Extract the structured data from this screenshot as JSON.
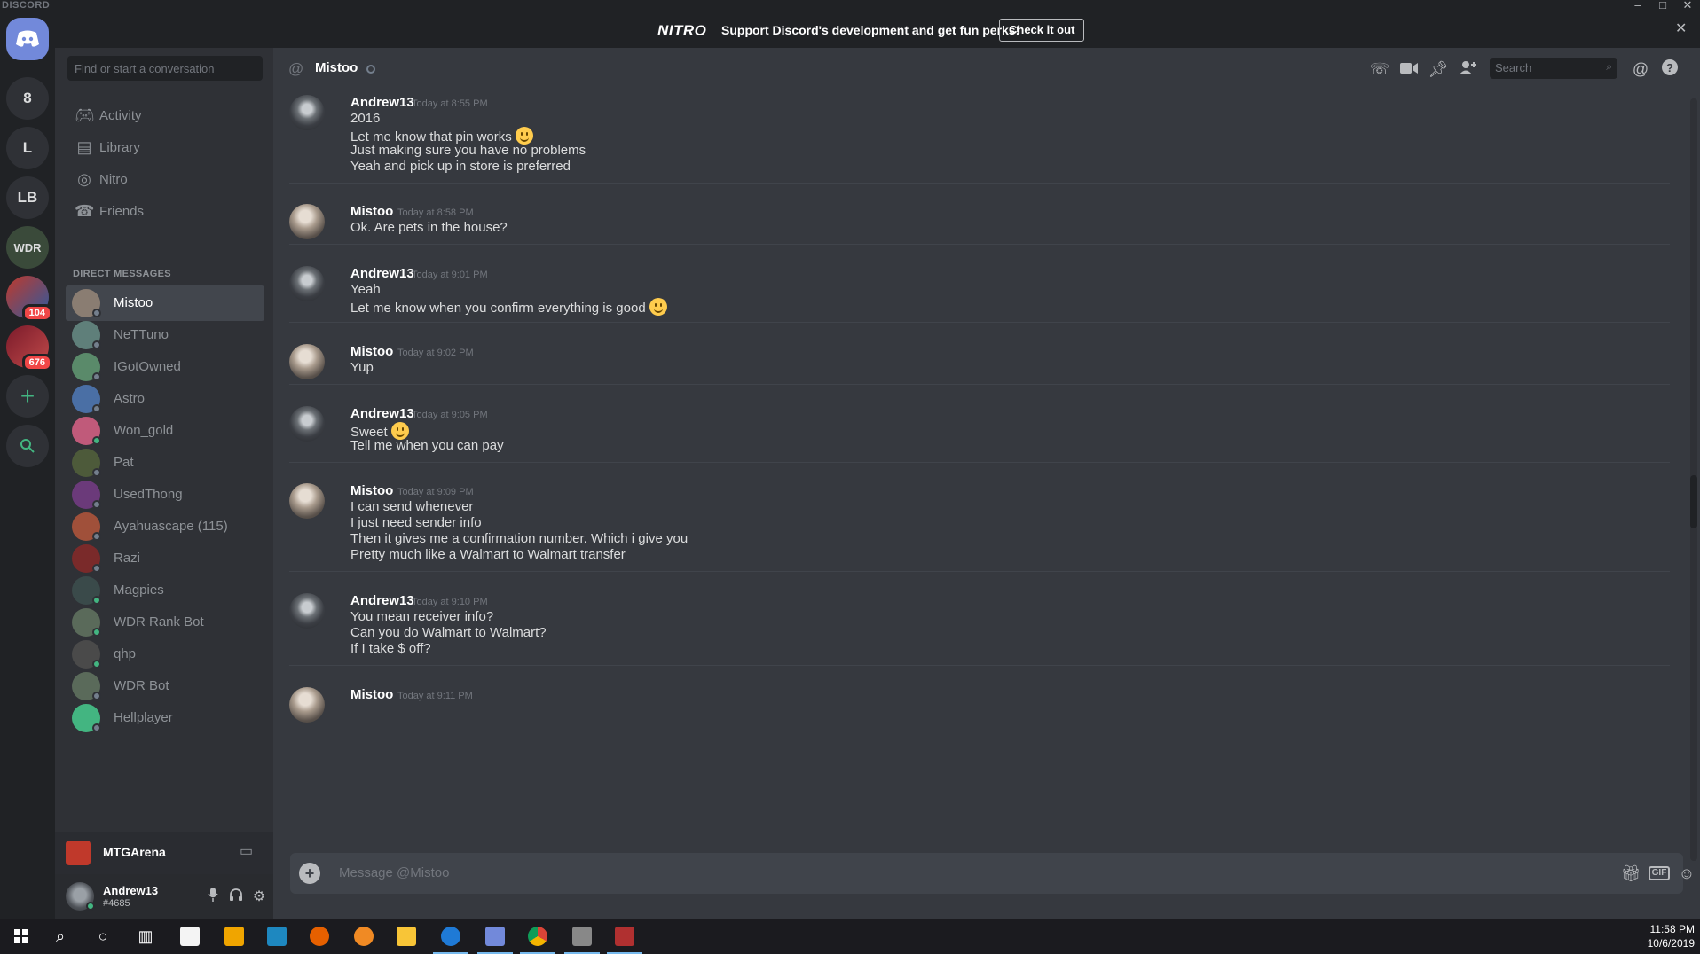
{
  "window": {
    "brand": "DISCORD"
  },
  "servers": [
    {
      "label": "8"
    },
    {
      "label": "L"
    },
    {
      "label": "LB"
    },
    {
      "label": "WDR"
    },
    {
      "label": "",
      "badge": "104"
    },
    {
      "label": "",
      "badge": "676"
    }
  ],
  "banner": {
    "logo": "NITRO",
    "message": "Support Discord's development and get fun perks!",
    "button": "Check it out"
  },
  "sidebar": {
    "search_placeholder": "Find or start a conversation",
    "nav": [
      {
        "label": "Activity",
        "icon": "gamepad-icon"
      },
      {
        "label": "Library",
        "icon": "library-icon"
      },
      {
        "label": "Nitro",
        "icon": "nitro-icon"
      },
      {
        "label": "Friends",
        "icon": "friends-icon"
      }
    ],
    "dm_header": "DIRECT MESSAGES",
    "dms": [
      {
        "name": "Mistoo",
        "status": "offline",
        "active": true,
        "color": "#8a7d72"
      },
      {
        "name": "NeTTuno",
        "status": "offline",
        "color": "#5f7f7a"
      },
      {
        "name": "IGotOwned",
        "status": "offline",
        "color": "#5a8a6a"
      },
      {
        "name": "Astro",
        "status": "offline",
        "color": "#4a6fa5"
      },
      {
        "name": "Won_gold",
        "status": "online",
        "color": "#c05a7a"
      },
      {
        "name": "Pat",
        "status": "offline",
        "color": "#4d5a3a"
      },
      {
        "name": "UsedThong",
        "status": "offline",
        "color": "#6b3a7a"
      },
      {
        "name": "Ayahuascape (115)",
        "status": "offline",
        "color": "#a0503a"
      },
      {
        "name": "Razi",
        "status": "offline",
        "color": "#7a2a2a"
      },
      {
        "name": "Magpies",
        "status": "online",
        "color": "#3a4a4a"
      },
      {
        "name": "WDR Rank Bot",
        "status": "online",
        "color": "#5a6a5a"
      },
      {
        "name": "qhp",
        "status": "online",
        "color": "#4a4a4a"
      },
      {
        "name": "WDR Bot",
        "status": "offline",
        "color": "#5a6a5a"
      },
      {
        "name": "Hellplayer",
        "status": "offline",
        "color": "#43b581"
      }
    ],
    "activity": {
      "game": "MTGArena"
    },
    "user": {
      "name": "Andrew13",
      "tag": "#4685"
    }
  },
  "chat": {
    "channel": "Mistoo",
    "search_placeholder": "Search",
    "composer_placeholder": "Message @Mistoo",
    "messages": [
      {
        "author": "Andrew13",
        "time": "Today at 8:55 PM",
        "lines": [
          "2016",
          "Let me know that pin works",
          "Just making sure you have no problems",
          "Yeah and pick up in store is preferred"
        ]
      },
      {
        "author": "Mistoo",
        "time": "Today at 8:58 PM",
        "lines": [
          "Ok. Are pets in the house?"
        ]
      },
      {
        "author": "Andrew13",
        "time": "Today at 9:01 PM",
        "lines": [
          "Yeah",
          "Let me know when you confirm everything is good"
        ]
      },
      {
        "author": "Mistoo",
        "time": "Today at 9:02 PM",
        "lines": [
          "Yup"
        ]
      },
      {
        "author": "Andrew13",
        "time": "Today at 9:05 PM",
        "lines": [
          "Sweet",
          "Tell me when you can pay"
        ]
      },
      {
        "author": "Mistoo",
        "time": "Today at 9:09 PM",
        "lines": [
          "I can send whenever",
          "I just need sender info",
          "Then it gives me a confirmation number. Which i give you",
          "Pretty much like a Walmart to Walmart transfer"
        ]
      },
      {
        "author": "Andrew13",
        "time": "Today at 9:10 PM",
        "lines": [
          "You mean receiver info?",
          "Can you do Walmart to Walmart?",
          "If I take $ off?"
        ]
      },
      {
        "author": "Mistoo",
        "time": "Today at 9:11 PM",
        "lines": []
      }
    ]
  },
  "taskbar": {
    "time": "11:58 PM",
    "date": "10/6/2019"
  },
  "colors": {
    "accent": "#7289da",
    "online": "#43b581",
    "danger": "#f04747"
  }
}
